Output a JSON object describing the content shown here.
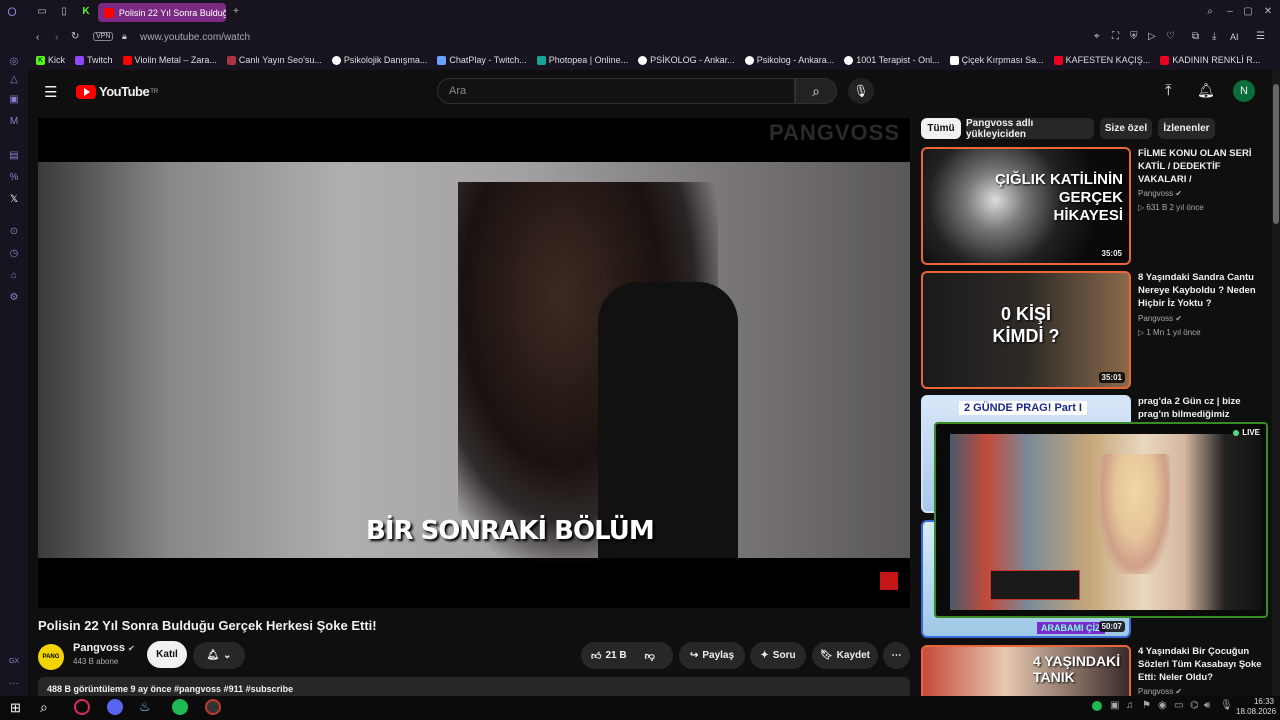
{
  "browser": {
    "active_tab": "Polisin 22 Yıl Sonra Bulduğ",
    "url": "www.youtube.com/watch",
    "vpn": "VPN",
    "ai": "AI",
    "bookmarks": [
      "Kick",
      "Twitch",
      "Violin Metal – Zara...",
      "Canlı Yayın Seo'su...",
      "Psikolojik Danışma...",
      "ChatPlay - Twitch...",
      "Photopea | Online...",
      "PSİKOLOG - Ankar...",
      "Psikolog - Ankara...",
      "1001 Terapist - Onl...",
      "Çiçek Kırpması Sa...",
      "KAFESTEN KAÇIŞ...",
      "KADININ RENKLİ R..."
    ]
  },
  "youtube": {
    "logo": "YouTube",
    "region": "TR",
    "search_placeholder": "Ara",
    "avatar": "N",
    "video_title": "Polisin 22 Yıl Sonra Bulduğu Gerçek Herkesi Şoke Etti!",
    "video_overlay_text": "BİR SONRAKİ BÖLÜM",
    "watermark": "PANGVOSS",
    "channel_name": "Pangvoss",
    "subscribers": "443 B abone",
    "join_label": "Katıl",
    "likes": "21 B",
    "share": "Paylaş",
    "ask": "Soru",
    "save": "Kaydet",
    "views_line": "488 B görüntüleme  9 ay önce  #pangvoss #911 #subscribe",
    "filters": [
      "Tümü",
      "Pangvoss adlı yükleyiciden",
      "Size özel",
      "İzlenenler"
    ],
    "recommended": [
      {
        "title": "FİLME KONU OLAN SERİ KATİL / DEDEKTİF VAKALARI /",
        "channel": "Pangvoss",
        "meta": "▷ 631 B   2 yıl önce",
        "duration": "35:05",
        "thumb_text": "ÇIĞLIK KATİLİNİN GERÇEK HİKAYESİ"
      },
      {
        "title": "8 Yaşındaki Sandra Cantu Nereye Kayboldu ? Neden Hiçbir İz Yoktu ?",
        "channel": "Pangvoss",
        "meta": "▷ 1 Mn   1 yıl önce",
        "duration": "35:01",
        "thumb_text": "0 KİŞİ KİMDİ ?"
      },
      {
        "title": "prag'da 2 Gün cz | bize prag'ın bilmediğimiz",
        "channel": "",
        "meta": "",
        "duration": "",
        "thumb_text": "2 GÜNDE PRAG! Part I"
      },
      {
        "title": "",
        "channel": "",
        "meta": "",
        "duration": "50:07",
        "thumb_text": "ARABAMI ÇİZ"
      },
      {
        "title": "4 Yaşındaki Bir Çocuğun Sözleri Tüm Kasabayı Şoke Etti: Neler Oldu?",
        "channel": "Pangvoss",
        "meta": "",
        "duration": "",
        "thumb_text": "4 YAŞINDAKİ TANIK"
      }
    ],
    "live_badge": "LIVE"
  },
  "taskbar": {
    "time": "16:33",
    "date": "18.08.2026"
  },
  "colors": {
    "accent": "#7b2a83",
    "yt_red": "#ff0000",
    "thumb_border": "#e8663a",
    "live_green": "#4ade80"
  }
}
